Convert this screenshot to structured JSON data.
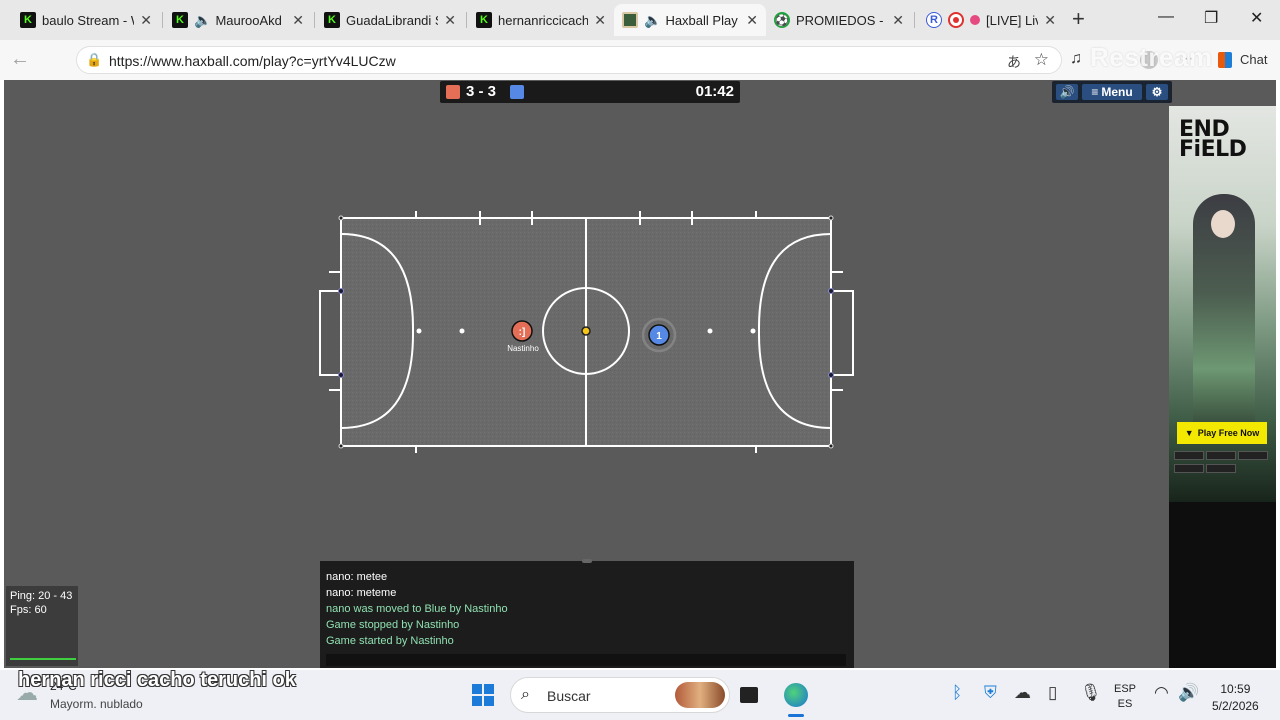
{
  "tabs": [
    {
      "title": "baulo Stream - W",
      "favicon": "kick-icon",
      "audio": false,
      "active": false
    },
    {
      "title": "MaurooAkd S",
      "favicon": "kick-icon",
      "audio": true,
      "active": false
    },
    {
      "title": "GuadaLibrandi St",
      "favicon": "kick-icon",
      "audio": false,
      "active": false
    },
    {
      "title": "hernanriccicachot",
      "favicon": "kick-icon",
      "audio": false,
      "active": false
    },
    {
      "title": "Haxball Play",
      "favicon": "haxball-icon",
      "audio": true,
      "active": true
    },
    {
      "title": "PROMIEDOS - Fu",
      "favicon": "soccer-ball-icon",
      "audio": false,
      "active": false
    },
    {
      "title": "[LIVE] Liv",
      "favicon": "record-icon",
      "audio": false,
      "active": false
    }
  ],
  "address_bar": {
    "url": "https://www.haxball.com/play?c=yrtYv4LUCzw"
  },
  "toolbar": {
    "restream_overlay": "Restream",
    "chat_label": "Chat"
  },
  "scoreboard": {
    "score": "3 - 3",
    "timer": "01:42",
    "red_color": "#e56e56",
    "blue_color": "#5689e5"
  },
  "game_menu": {
    "sound_icon": "speaker-icon",
    "menu_label": "Menu",
    "settings_icon": "gear-icon"
  },
  "players": [
    {
      "team": "red",
      "avatar": ":]",
      "name": "Nastinho"
    },
    {
      "team": "blue",
      "avatar": "1",
      "name": ""
    }
  ],
  "stats": {
    "ping": "Ping: 20 - 43",
    "fps": "Fps: 60"
  },
  "chat": {
    "messages": [
      {
        "text": "nano: metee",
        "system": false
      },
      {
        "text": "nano: meteme",
        "system": false
      },
      {
        "text": "nano was moved to Blue by Nastinho",
        "system": true
      },
      {
        "text": "Game stopped by Nastinho",
        "system": true
      },
      {
        "text": "Game started by Nastinho",
        "system": true
      }
    ]
  },
  "ad": {
    "brand_line1": "END",
    "brand_line2": "FiELD",
    "cta": "Play Free Now"
  },
  "taskbar": {
    "weather_temp": "24°C",
    "weather_desc": "Mayorm. nublado",
    "search_placeholder": "Buscar",
    "lang_line1": "ESP",
    "lang_line2": "ES",
    "time": "10:59",
    "date": "5/2/2026"
  },
  "overlay_caption": "hernan ricci cacho teruchi ok"
}
